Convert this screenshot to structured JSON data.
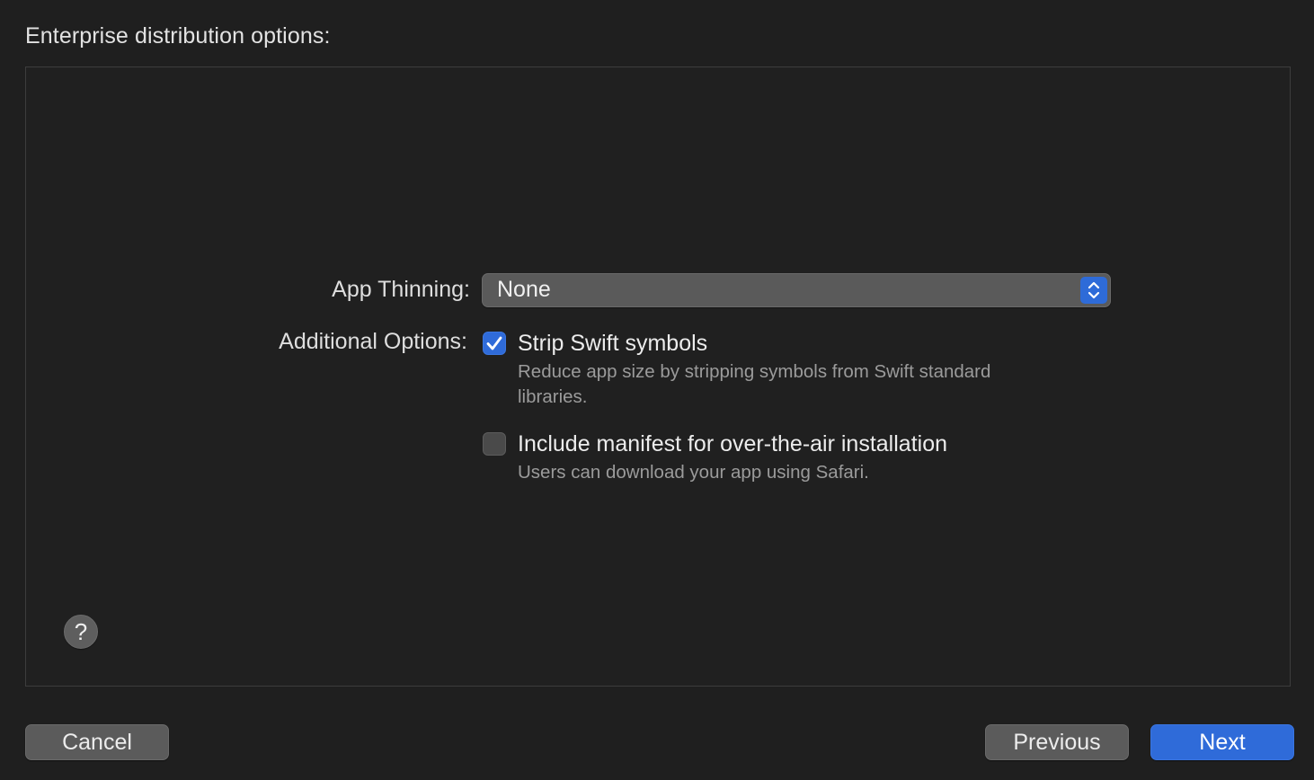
{
  "header": {
    "title": "Enterprise distribution options:"
  },
  "form": {
    "app_thinning": {
      "label": "App Thinning:",
      "selected": "None"
    },
    "additional_options": {
      "label": "Additional Options:",
      "options": [
        {
          "title": "Strip Swift symbols",
          "description": "Reduce app size by stripping symbols from Swift standard libraries.",
          "checked": true
        },
        {
          "title": "Include manifest for over-the-air installation",
          "description": "Users can download your app using Safari.",
          "checked": false
        }
      ]
    }
  },
  "help": {
    "glyph": "?"
  },
  "footer": {
    "cancel_label": "Cancel",
    "previous_label": "Previous",
    "next_label": "Next"
  },
  "colors": {
    "background": "#1f1f1f",
    "accent": "#2f6bd9",
    "button_secondary": "#5b5b5b",
    "secondary_text": "#9b9b9b"
  },
  "icons": {
    "popup_indicator": "chevron-up-down-icon",
    "checkbox_check": "checkmark-icon",
    "help": "question-mark-icon"
  }
}
